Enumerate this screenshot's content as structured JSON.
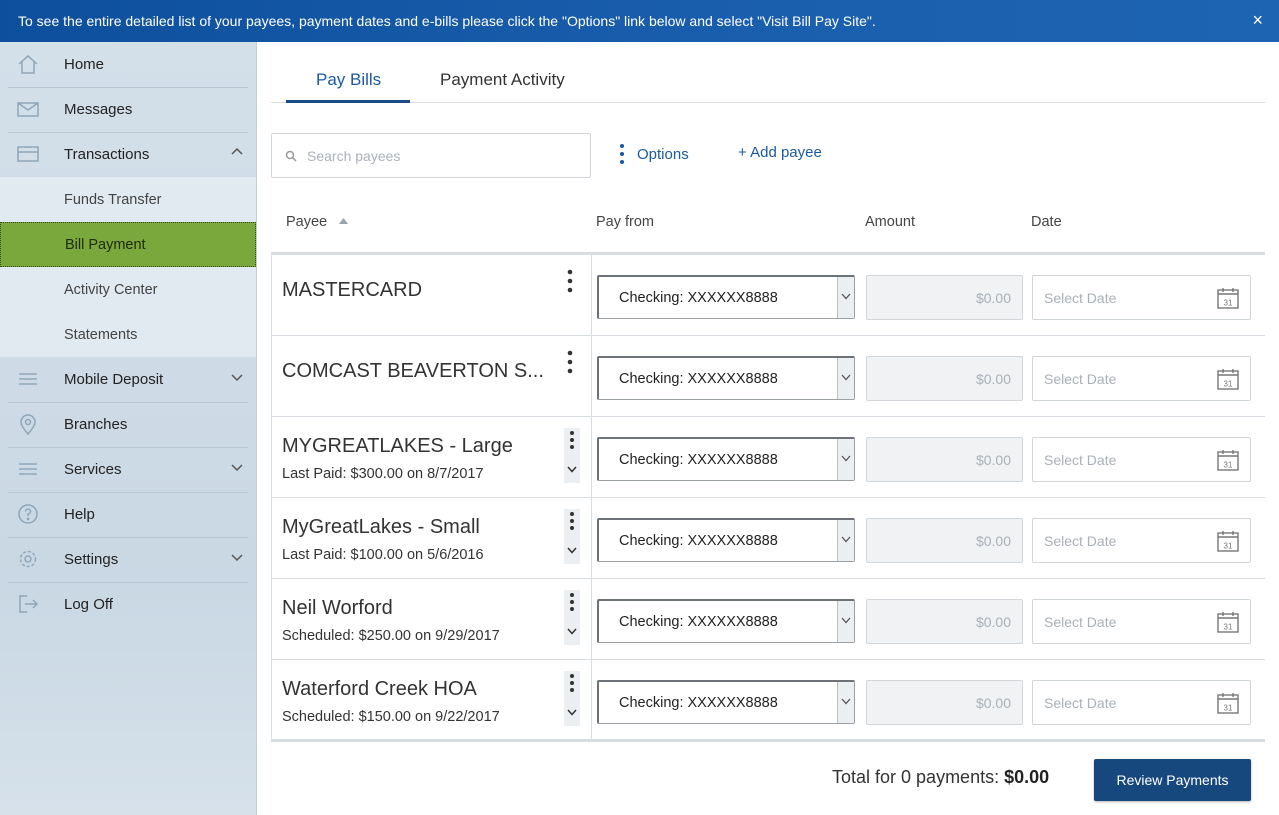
{
  "banner": {
    "text": "To see the entire detailed list of your payees, payment dates and e-bills please click the \"Options\" link below and select \"Visit Bill Pay Site\".",
    "close": "×"
  },
  "nav": {
    "home": "Home",
    "messages": "Messages",
    "transactions": "Transactions",
    "funds_transfer": "Funds Transfer",
    "bill_payment": "Bill Payment",
    "activity_center": "Activity Center",
    "statements": "Statements",
    "mobile_deposit": "Mobile Deposit",
    "branches": "Branches",
    "services": "Services",
    "help": "Help",
    "settings": "Settings",
    "log_off": "Log Off"
  },
  "tabs": {
    "pay_bills": "Pay Bills",
    "payment_activity": "Payment Activity"
  },
  "search": {
    "placeholder": "Search payees",
    "value": ""
  },
  "actions": {
    "options": "Options",
    "add_payee": "+ Add payee"
  },
  "columns": {
    "payee": "Payee",
    "pay_from": "Pay from",
    "amount": "Amount",
    "date": "Date"
  },
  "payees": [
    {
      "name": "MASTERCARD",
      "sub": "",
      "account": "Checking: XXXXXX8888",
      "amount_placeholder": "$0.00",
      "date_placeholder": "Select Date"
    },
    {
      "name": "COMCAST BEAVERTON S...",
      "sub": "",
      "account": "Checking: XXXXXX8888",
      "amount_placeholder": "$0.00",
      "date_placeholder": "Select Date"
    },
    {
      "name": "MYGREATLAKES - Large",
      "sub": "Last Paid: $300.00 on 8/7/2017",
      "account": "Checking: XXXXXX8888",
      "amount_placeholder": "$0.00",
      "date_placeholder": "Select Date"
    },
    {
      "name": "MyGreatLakes - Small",
      "sub": "Last Paid: $100.00 on 5/6/2016",
      "account": "Checking: XXXXXX8888",
      "amount_placeholder": "$0.00",
      "date_placeholder": "Select Date"
    },
    {
      "name": "Neil Worford",
      "sub": "Scheduled: $250.00 on 9/29/2017",
      "account": "Checking: XXXXXX8888",
      "amount_placeholder": "$0.00",
      "date_placeholder": "Select Date"
    },
    {
      "name": "Waterford Creek HOA",
      "sub": "Scheduled: $150.00 on 9/22/2017",
      "account": "Checking: XXXXXX8888",
      "amount_placeholder": "$0.00",
      "date_placeholder": "Select Date"
    }
  ],
  "calendar_day": "31",
  "footer": {
    "total_label": "Total for 0 payments:",
    "total_value": "$0.00",
    "review_button": "Review Payments"
  },
  "colors": {
    "banner": "#1a5fae",
    "accent": "#1a5aa0",
    "active_nav": "#7aa83c",
    "primary_button": "#16487d"
  }
}
